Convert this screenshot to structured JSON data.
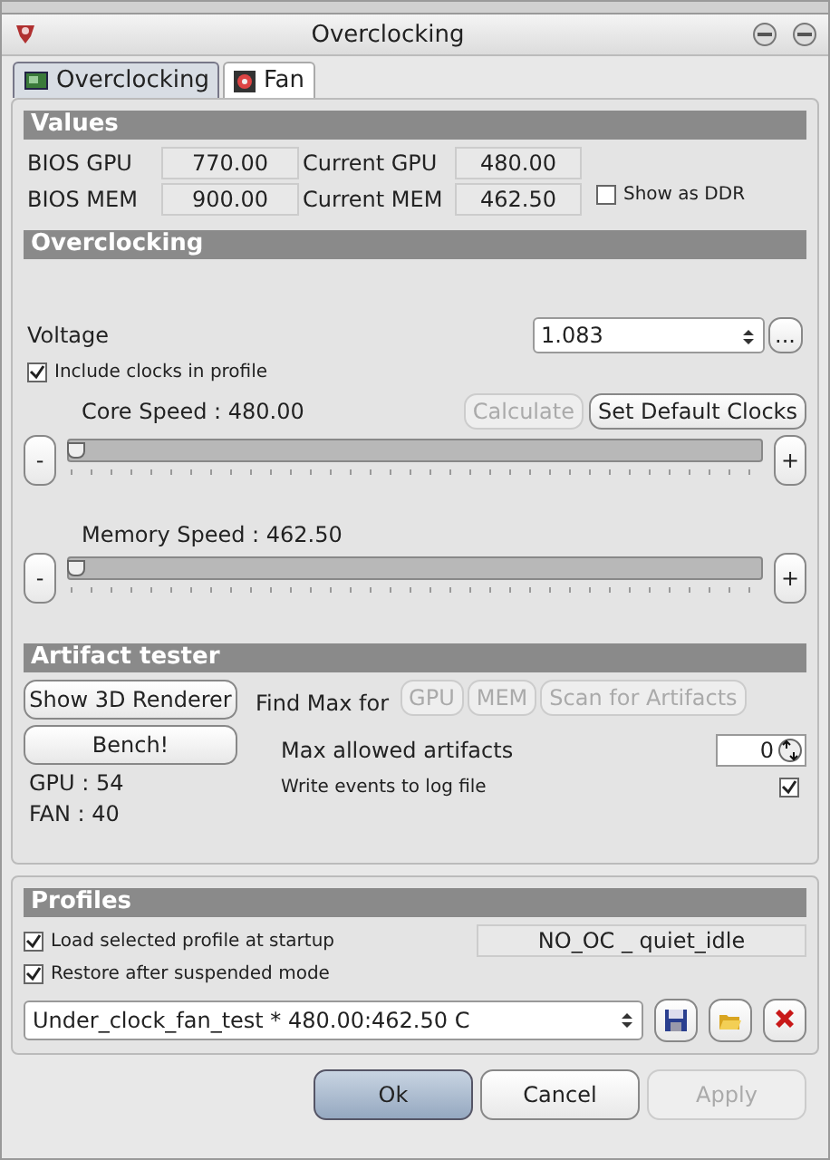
{
  "window": {
    "title": "Overclocking"
  },
  "tabs": [
    {
      "label": "Overclocking",
      "kind": "card",
      "selected": true
    },
    {
      "label": "Fan",
      "kind": "fan",
      "selected": false
    }
  ],
  "values": {
    "title": "Values",
    "fields": [
      {
        "label": "BIOS GPU",
        "value": "770.00"
      },
      {
        "label": "Current GPU",
        "value": "480.00"
      },
      {
        "label": "BIOS MEM",
        "value": "900.00"
      },
      {
        "label": "Current MEM",
        "value": "462.50"
      }
    ],
    "show_ddr": {
      "label": "Show as DDR",
      "checked": false
    }
  },
  "overclocking": {
    "title": "Overclocking",
    "voltage_label": "Voltage",
    "voltage_value": "1.083",
    "more_button": "...",
    "include_clocks": {
      "label": "Include clocks in profile",
      "checked": true
    },
    "buttons": [
      {
        "label": "Calculate",
        "disabled": true
      },
      {
        "label": "Set Default Clocks",
        "disabled": false
      }
    ],
    "sliders": [
      {
        "label": "Core Speed : 480.00",
        "level": 0,
        "minus": "-",
        "plus": "+"
      },
      {
        "label": "Memory Speed : 462.50",
        "level": 0,
        "minus": "-",
        "plus": "+"
      }
    ]
  },
  "artifact": {
    "title": "Artifact tester",
    "show_button": "Show 3D Renderer",
    "bench_button": "Bench!",
    "find_max_label": "Find Max for",
    "find_buttons": [
      {
        "label": "GPU",
        "disabled": true
      },
      {
        "label": "MEM",
        "disabled": true
      },
      {
        "label": "Scan for Artifacts",
        "disabled": true
      }
    ],
    "max_label": "Max allowed artifacts",
    "max_value": "0",
    "log": {
      "label": "Write events to log file",
      "checked": true
    },
    "readings": [
      "GPU : 54",
      "FAN : 40"
    ]
  },
  "profiles": {
    "title": "Profiles",
    "load": {
      "label": "Load selected profile at startup",
      "checked": true
    },
    "current": "NO_OC _ quiet_idle",
    "restore": {
      "label": "Restore after suspended mode",
      "checked": true
    },
    "selected": "Under_clock_fan_test * 480.00:462.50 C"
  },
  "buttons": [
    {
      "label": "Ok",
      "default": true,
      "disabled": false
    },
    {
      "label": "Cancel",
      "default": false,
      "disabled": false
    },
    {
      "label": "Apply",
      "default": false,
      "disabled": true
    }
  ]
}
